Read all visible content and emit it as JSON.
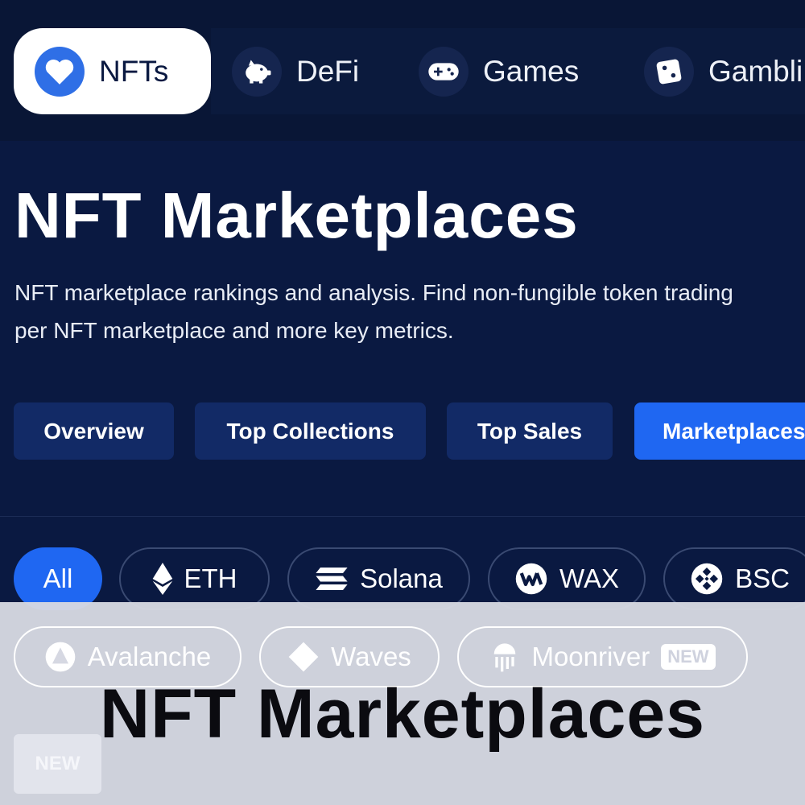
{
  "categories": [
    {
      "label": "NFTs",
      "icon": "heart-icon",
      "active": true
    },
    {
      "label": "DeFi",
      "icon": "piggy-bank-icon",
      "active": false
    },
    {
      "label": "Games",
      "icon": "gamepad-icon",
      "active": false
    },
    {
      "label": "Gambli",
      "icon": "dice-icon",
      "active": false
    }
  ],
  "page": {
    "title": "NFT Marketplaces",
    "description_line1": "NFT marketplace rankings and analysis. Find non-fungible token trading",
    "description_line2": "per NFT marketplace and more key metrics."
  },
  "tabs": [
    {
      "label": "Overview",
      "active": false
    },
    {
      "label": "Top Collections",
      "active": false
    },
    {
      "label": "Top Sales",
      "active": false
    },
    {
      "label": "Marketplaces",
      "active": true
    }
  ],
  "chains": [
    {
      "label": "All",
      "icon": "",
      "active": true
    },
    {
      "label": "ETH",
      "icon": "ethereum-icon",
      "active": false
    },
    {
      "label": "Solana",
      "icon": "solana-icon",
      "active": false
    },
    {
      "label": "WAX",
      "icon": "wax-icon",
      "active": false
    },
    {
      "label": "BSC",
      "icon": "bsc-icon",
      "active": false
    },
    {
      "label": "Avalanche",
      "icon": "avalanche-icon",
      "active": false
    },
    {
      "label": "Waves",
      "icon": "waves-icon",
      "active": false
    },
    {
      "label": "Moonriver",
      "icon": "moonriver-icon",
      "active": false,
      "badge": "NEW"
    }
  ],
  "overlay": {
    "title": "NFT Marketplaces",
    "badge": "NEW"
  },
  "colors": {
    "background": "#0a1941",
    "accent": "#1f67f2",
    "tab": "#122a66"
  }
}
